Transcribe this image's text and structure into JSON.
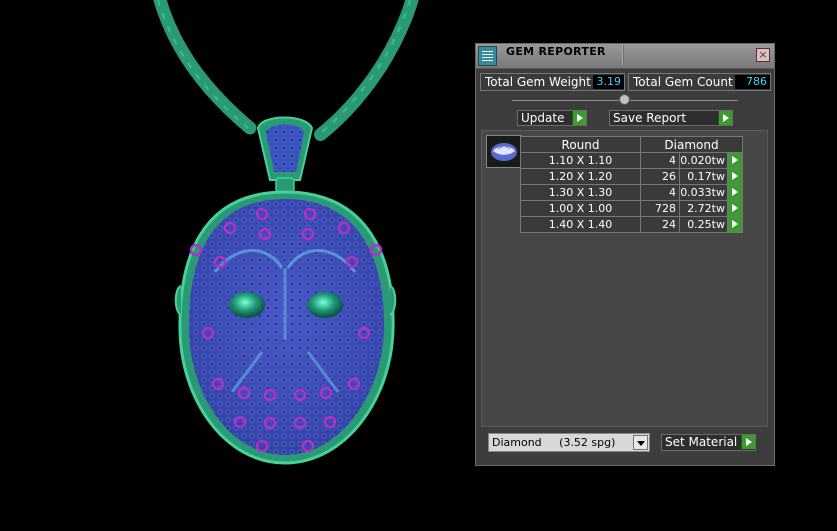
{
  "panel": {
    "title": "GEM REPORTER",
    "close_glyph": "×",
    "total_gem_weight_label": "Total Gem Weight",
    "total_gem_weight_value": "3.19",
    "total_gem_count_label": "Total Gem Count",
    "total_gem_count_value": "786",
    "update_label": "Update",
    "save_report_label": "Save Report",
    "gem_group": {
      "shape": "Round",
      "material": "Diamond",
      "icon": "round-gem-icon",
      "rows": [
        {
          "size": "1.10 X 1.10",
          "count": "4",
          "weight": "0.020tw"
        },
        {
          "size": "1.20 X 1.20",
          "count": "26",
          "weight": "0.17tw"
        },
        {
          "size": "1.30 X 1.30",
          "count": "4",
          "weight": "0.033tw"
        },
        {
          "size": "1.00 X 1.00",
          "count": "728",
          "weight": "2.72tw"
        },
        {
          "size": "1.40 X 1.40",
          "count": "24",
          "weight": "0.25tw"
        }
      ]
    },
    "material_select_value": "Diamond     (3.52 spg)",
    "set_material_label": "Set Material"
  },
  "colors": {
    "accent_green": "#3d9b32",
    "value_blue": "#3fd0ff",
    "chain_green": "#2e9e78",
    "mask_blue": "#3a4fc0"
  },
  "viewport": {
    "object": "mask pendant on rope chain"
  }
}
